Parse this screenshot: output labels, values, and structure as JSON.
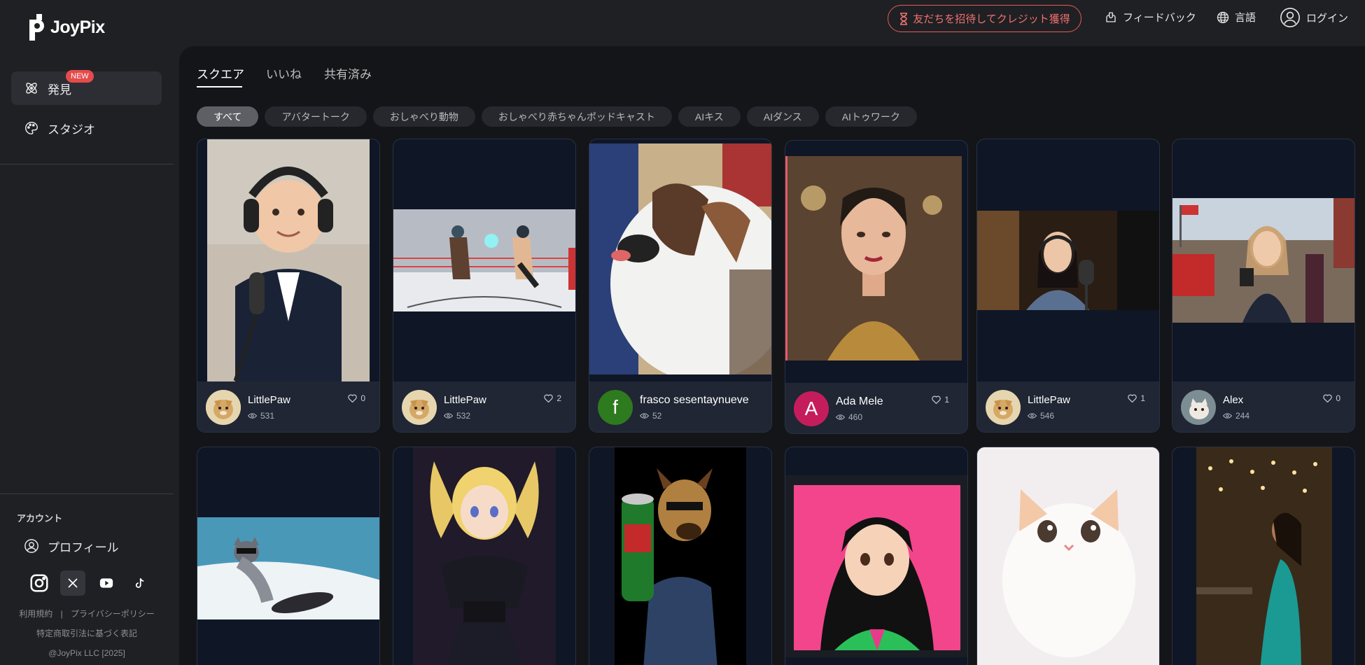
{
  "app": {
    "name": "JoyPix"
  },
  "sidebar": {
    "nav": [
      {
        "label": "発見",
        "badge": "NEW"
      },
      {
        "label": "スタジオ"
      }
    ],
    "account_heading": "アカウント",
    "profile_label": "プロフィール",
    "socials": [
      "instagram-icon",
      "x-icon",
      "youtube-icon",
      "tiktok-icon"
    ],
    "legal": {
      "terms": "利用規約",
      "divider": "|",
      "privacy": "プライバシーポリシー",
      "commerce": "特定商取引法に基づく表記",
      "copyright": "@JoyPix LLC [2025]"
    }
  },
  "topbar": {
    "invite": "友だちを招待してクレジット獲得",
    "feedback": "フィードバック",
    "language": "言語",
    "login": "ログイン"
  },
  "tabs": [
    "スクエア",
    "いいね",
    "共有済み"
  ],
  "filters": [
    "すべて",
    "アバタートーク",
    "おしゃべり動物",
    "おしゃべり赤ちゃんポッドキャスト",
    "AIキス",
    "AIダンス",
    "AIトゥワーク"
  ],
  "colors": {
    "accent": "#e35b5b",
    "card_bg": "#0f1626",
    "footer_bg": "#202634"
  },
  "cards": [
    {
      "user": "LittlePaw",
      "views": "531",
      "likes": "0",
      "avatar": "dog",
      "subject": "baby in suit with headphones and microphone"
    },
    {
      "user": "LittlePaw",
      "views": "532",
      "likes": "2",
      "avatar": "dog",
      "subject": "anime boxers in ring"
    },
    {
      "user": "frasco sesentaynueve",
      "views": "52",
      "likes": "0",
      "avatar": "f",
      "subject": "dog close-up"
    },
    {
      "user": "Ada Mele",
      "views": "460",
      "likes": "1",
      "avatar": "A",
      "subject": "woman in gold dress"
    },
    {
      "user": "LittlePaw",
      "views": "546",
      "likes": "1",
      "avatar": "dog",
      "subject": "woman with headset at microphone"
    },
    {
      "user": "Alex",
      "views": "244",
      "likes": "0",
      "avatar": "cat",
      "subject": "reporter at parade"
    },
    {
      "subject": "cat snowboarding"
    },
    {
      "subject": "anime girl in black dress"
    },
    {
      "subject": "dog-headed man with can"
    },
    {
      "subject": "anime girl with dark hair"
    },
    {
      "subject": "chubby white cat"
    },
    {
      "subject": "woman in teal dress"
    }
  ]
}
